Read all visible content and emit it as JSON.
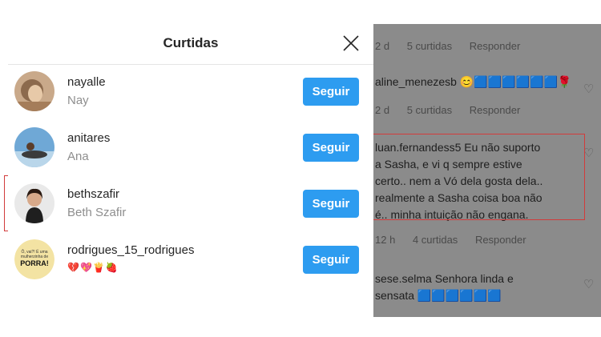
{
  "modal": {
    "title": "Curtidas",
    "users": [
      {
        "username": "nayalle",
        "name": "Nay",
        "button": "Seguir"
      },
      {
        "username": "anitares",
        "name": "Ana",
        "button": "Seguir"
      },
      {
        "username": "bethszafir",
        "name": "Beth Szafir",
        "button": "Seguir"
      },
      {
        "username": "rodrigues_15_rodrigues",
        "name": "💔💖🍟🍓",
        "button": "Seguir"
      }
    ],
    "avatar4_text": [
      "Ô, vai?! É uma",
      "mulherzinha de",
      "PORRA!"
    ]
  },
  "comments": {
    "c1_meta": {
      "time": "2 d",
      "likes": "5 curtidas",
      "reply": "Responder"
    },
    "c2": {
      "user": "aline_menezesb",
      "text": "😊🟦🟦🟦🟦🟦🟦🌹"
    },
    "c2_meta": {
      "time": "2 d",
      "likes": "5 curtidas",
      "reply": "Responder"
    },
    "c3": {
      "lines": [
        "luan.fernandess5 Eu não suporto",
        "a Sasha, e vi q sempre estive",
        "certo.. nem a Vó dela gosta dela..",
        "realmente a Sasha coisa boa não",
        "é.. minha intuição não engana."
      ]
    },
    "c3_meta": {
      "time": "12 h",
      "likes": "4 curtidas",
      "reply": "Responder"
    },
    "c4": {
      "lines": [
        "sese.selma Senhora linda e",
        "sensata 🟦🟦🟦🟦🟦🟦"
      ]
    }
  },
  "colors": {
    "follow_button": "#2d9cf0",
    "highlight": "#d23b3b",
    "overlay": "#8b8b8b"
  }
}
